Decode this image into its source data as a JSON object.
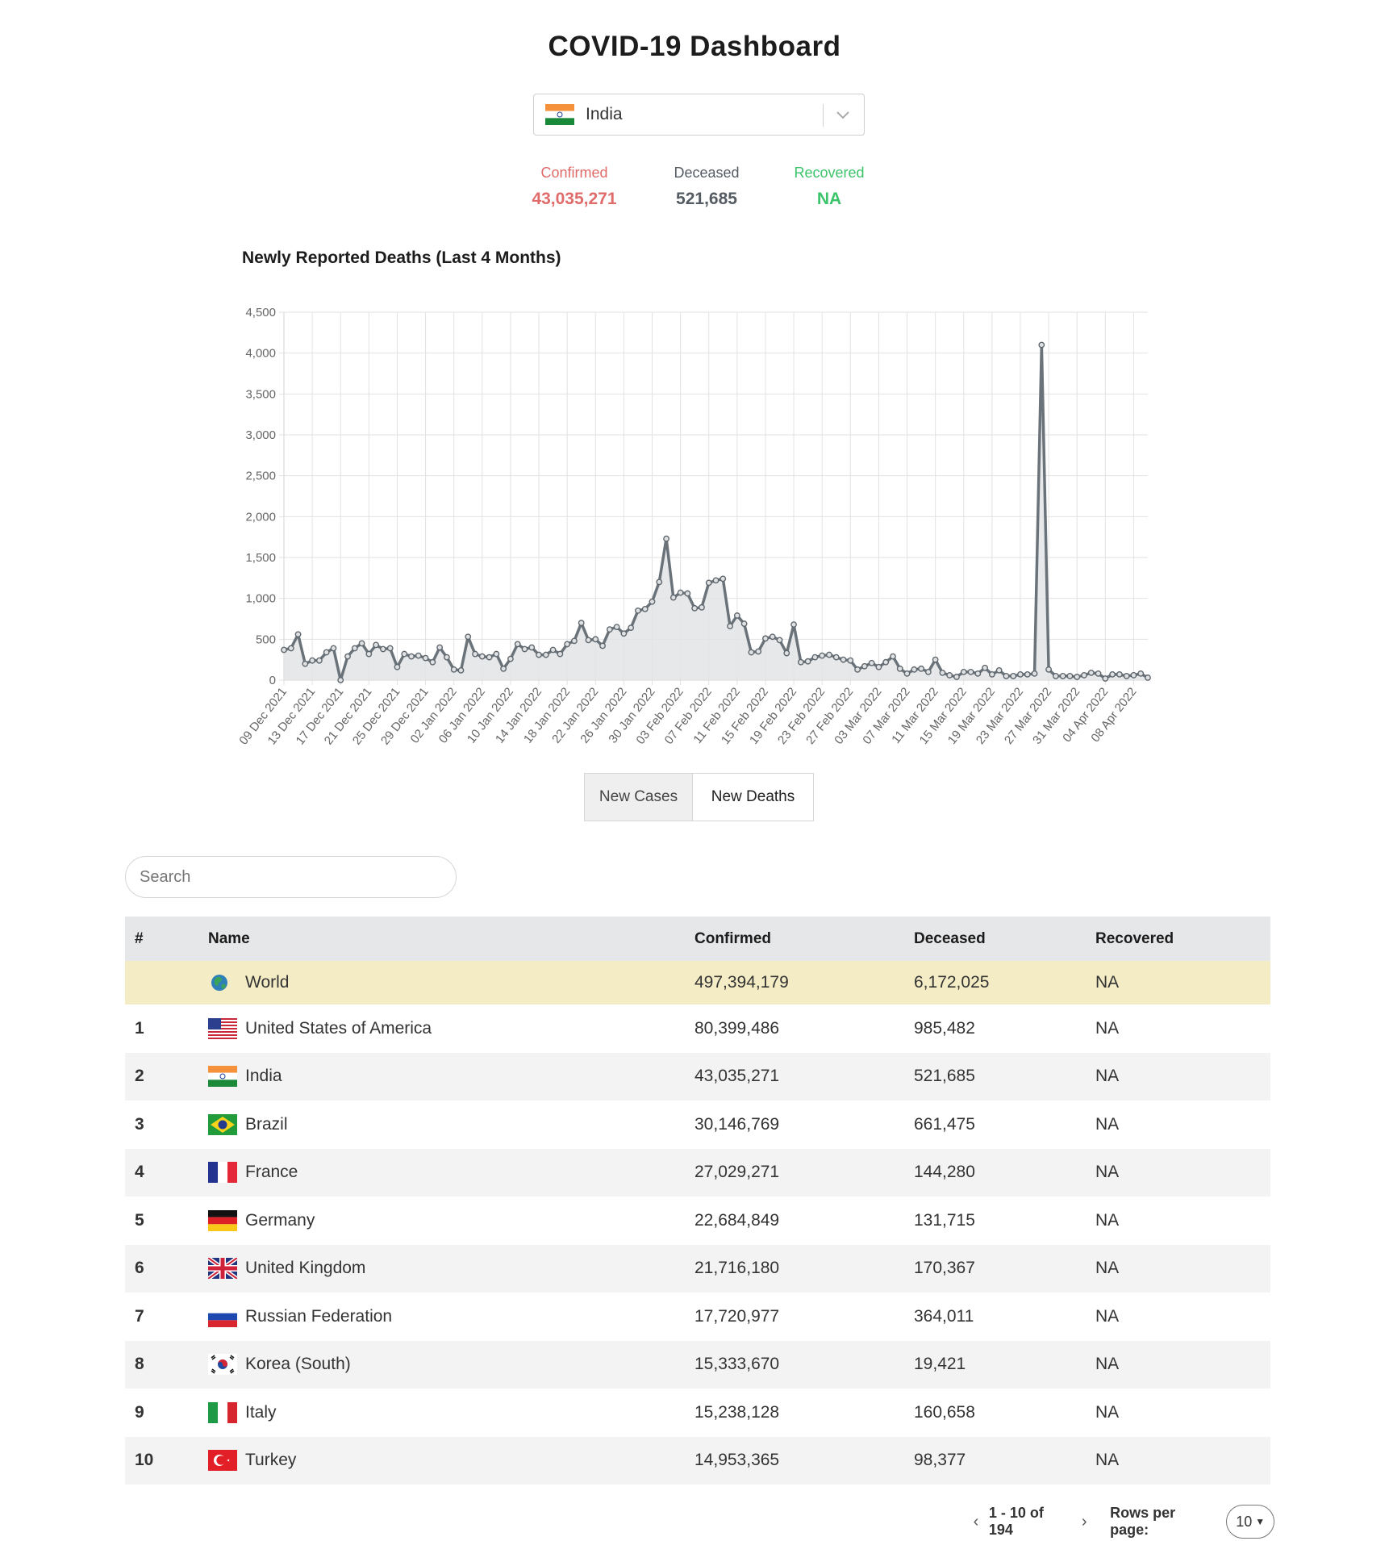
{
  "page": {
    "title": "COVID-19 Dashboard"
  },
  "country_select": {
    "selected": "India",
    "flag": "india-flag"
  },
  "stats": {
    "confirmed_label": "Confirmed",
    "confirmed_value": "43,035,271",
    "deceased_label": "Deceased",
    "deceased_value": "521,685",
    "recovered_label": "Recovered",
    "recovered_value": "NA"
  },
  "colors": {
    "confirmed": "#e06b6b",
    "deceased": "#555b63",
    "recovered": "#3cc46b",
    "world_row": "#f4ecc5",
    "line": "#6b737a",
    "area": "#e3e4e6"
  },
  "chart_data": {
    "type": "area",
    "title": "Newly Reported Deaths (Last 4 Months)",
    "xlabel": "",
    "ylabel": "",
    "ylim": [
      0,
      4500
    ],
    "yticks": [
      0,
      500,
      1000,
      1500,
      2000,
      2500,
      3000,
      3500,
      4000,
      4500
    ],
    "grid": true,
    "x_labels": [
      "09 Dec 2021",
      "13 Dec 2021",
      "17 Dec 2021",
      "21 Dec 2021",
      "25 Dec 2021",
      "29 Dec 2021",
      "02 Jan 2022",
      "06 Jan 2022",
      "10 Jan 2022",
      "14 Jan 2022",
      "18 Jan 2022",
      "22 Jan 2022",
      "26 Jan 2022",
      "30 Jan 2022",
      "03 Feb 2022",
      "07 Feb 2022",
      "11 Feb 2022",
      "15 Feb 2022",
      "19 Feb 2022",
      "23 Feb 2022",
      "27 Feb 2022",
      "03 Mar 2022",
      "07 Mar 2022",
      "11 Mar 2022",
      "15 Mar 2022",
      "19 Mar 2022",
      "23 Mar 2022",
      "27 Mar 2022",
      "31 Mar 2022",
      "04 Apr 2022",
      "08 Apr 2022"
    ],
    "series": [
      {
        "values": [
          370,
          390,
          560,
          200,
          240,
          240,
          340,
          390,
          0,
          290,
          390,
          450,
          320,
          430,
          380,
          390,
          160,
          320,
          290,
          300,
          270,
          220,
          400,
          280,
          130,
          120,
          530,
          320,
          290,
          280,
          320,
          140,
          260,
          440,
          380,
          400,
          310,
          310,
          370,
          320,
          440,
          480,
          700,
          490,
          500,
          420,
          620,
          650,
          570,
          640,
          850,
          870,
          960,
          1200,
          1730,
          1010,
          1070,
          1060,
          880,
          890,
          1190,
          1220,
          1240,
          660,
          790,
          690,
          340,
          350,
          510,
          530,
          490,
          330,
          680,
          220,
          230,
          280,
          300,
          310,
          280,
          250,
          240,
          130,
          170,
          210,
          160,
          220,
          290,
          140,
          80,
          130,
          140,
          100,
          250,
          90,
          60,
          40,
          100,
          100,
          80,
          150,
          70,
          120,
          50,
          50,
          70,
          70,
          80,
          4100,
          130,
          50,
          50,
          50,
          40,
          60,
          90,
          80,
          20,
          70,
          70,
          50,
          60,
          80,
          30
        ]
      }
    ]
  },
  "toggle": {
    "cases_label": "New Cases",
    "deaths_label": "New Deaths"
  },
  "search": {
    "placeholder": "Search"
  },
  "table": {
    "headers": {
      "rank": "#",
      "name": "Name",
      "confirmed": "Confirmed",
      "deceased": "Deceased",
      "recovered": "Recovered"
    },
    "world": {
      "name": "World",
      "confirmed": "497,394,179",
      "deceased": "6,172,025",
      "recovered": "NA",
      "icon": "globe-icon"
    },
    "rows": [
      {
        "rank": "1",
        "name": "United States of America",
        "flag": "usa-flag",
        "confirmed": "80,399,486",
        "deceased": "985,482",
        "recovered": "NA"
      },
      {
        "rank": "2",
        "name": "India",
        "flag": "india-flag",
        "confirmed": "43,035,271",
        "deceased": "521,685",
        "recovered": "NA"
      },
      {
        "rank": "3",
        "name": "Brazil",
        "flag": "brazil-flag",
        "confirmed": "30,146,769",
        "deceased": "661,475",
        "recovered": "NA"
      },
      {
        "rank": "4",
        "name": "France",
        "flag": "france-flag",
        "confirmed": "27,029,271",
        "deceased": "144,280",
        "recovered": "NA"
      },
      {
        "rank": "5",
        "name": "Germany",
        "flag": "germany-flag",
        "confirmed": "22,684,849",
        "deceased": "131,715",
        "recovered": "NA"
      },
      {
        "rank": "6",
        "name": "United Kingdom",
        "flag": "uk-flag",
        "confirmed": "21,716,180",
        "deceased": "170,367",
        "recovered": "NA"
      },
      {
        "rank": "7",
        "name": "Russian Federation",
        "flag": "russia-flag",
        "confirmed": "17,720,977",
        "deceased": "364,011",
        "recovered": "NA"
      },
      {
        "rank": "8",
        "name": "Korea (South)",
        "flag": "south-korea-flag",
        "confirmed": "15,333,670",
        "deceased": "19,421",
        "recovered": "NA"
      },
      {
        "rank": "9",
        "name": "Italy",
        "flag": "italy-flag",
        "confirmed": "15,238,128",
        "deceased": "160,658",
        "recovered": "NA"
      },
      {
        "rank": "10",
        "name": "Turkey",
        "flag": "turkey-flag",
        "confirmed": "14,953,365",
        "deceased": "98,377",
        "recovered": "NA"
      }
    ]
  },
  "pagination": {
    "prev_icon": "chevron-left-icon",
    "range": "1 - 10 of 194",
    "next_icon": "chevron-right-icon",
    "rows_label": "Rows per page:",
    "rows_value": "10"
  }
}
